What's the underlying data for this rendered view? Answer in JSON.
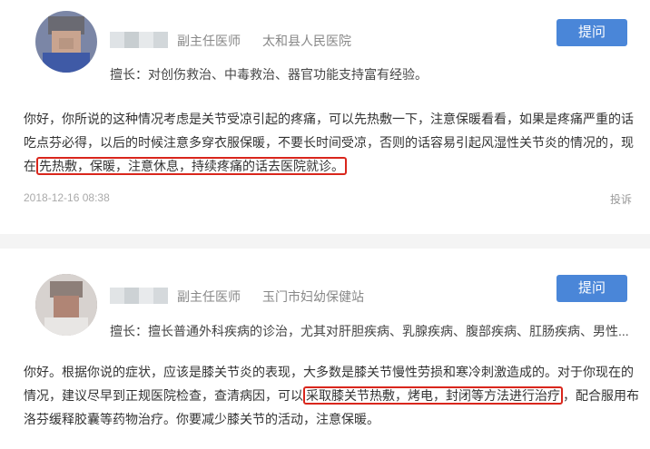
{
  "answers": [
    {
      "doctor": {
        "title": "副主任医师",
        "hospital": "太和县人民医院",
        "specialty": "擅长：对创伤救治、中毒救治、器官功能支持富有经验。"
      },
      "ask_button": "提问",
      "text_before": "你好，你所说的这种情况考虑是关节受凉引起的疼痛，可以先热敷一下，注意保暖看看，如果是疼痛严重的话吃点芬必得，以后的时候注意多穿衣服保暖，不要长时间受凉，否则的话容易引起风湿性关节炎的情况的，现在",
      "text_highlight": "先热敷，保暖，注意休息，持续疼痛的话去医院就诊。",
      "text_after": "",
      "date": "2018-12-16 08:38",
      "report": "投诉"
    },
    {
      "doctor": {
        "title": "副主任医师",
        "hospital": "玉门市妇幼保健站",
        "specialty": "擅长：擅长普通外科疾病的诊治，尤其对肝胆疾病、乳腺疾病、腹部疾病、肛肠疾病、男性..."
      },
      "ask_button": "提问",
      "text_before": "你好。根据你说的症状，应该是膝关节炎的表现，大多数是膝关节慢性劳损和寒冷刺激造成的。对于你现在的情况，建议尽早到正规医院检查，查清病因，可以",
      "text_highlight": "采取膝关节热敷，烤电，封闭等方法进行治疗",
      "text_after": "，配合服用布洛芬缓释胶囊等药物治疗。你要减少膝关节的活动，注意保暖。"
    }
  ],
  "colors": {
    "button": "#4a86d8",
    "highlight_border": "#d9261c",
    "muted": "#888888"
  }
}
